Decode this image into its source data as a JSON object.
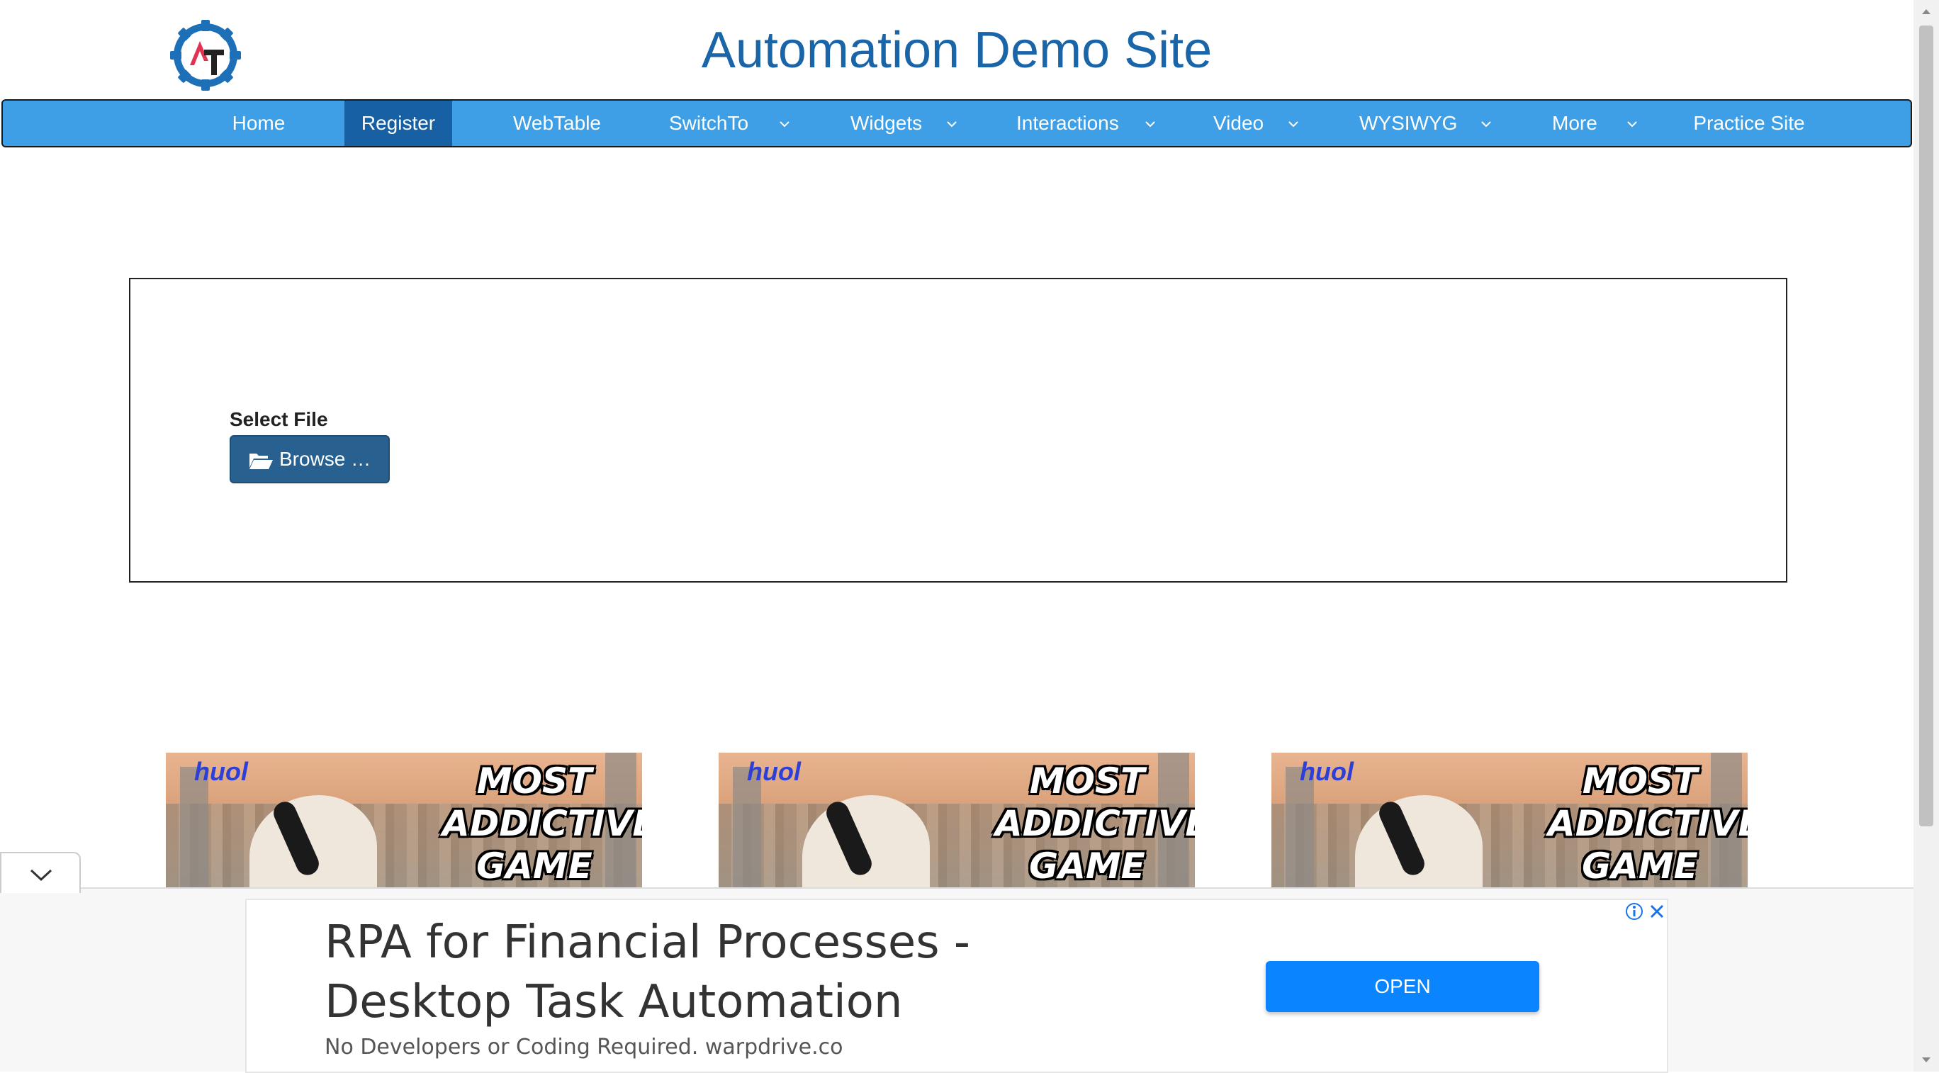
{
  "header": {
    "title": "Automation Demo Site"
  },
  "nav": {
    "items": [
      {
        "label": "Home",
        "active": false,
        "dropdown": false
      },
      {
        "label": "Register",
        "active": true,
        "dropdown": false
      },
      {
        "label": "WebTable",
        "active": false,
        "dropdown": false
      },
      {
        "label": "SwitchTo",
        "active": false,
        "dropdown": true
      },
      {
        "label": "Widgets",
        "active": false,
        "dropdown": true
      },
      {
        "label": "Interactions",
        "active": false,
        "dropdown": true
      },
      {
        "label": "Video",
        "active": false,
        "dropdown": true
      },
      {
        "label": "WYSIWYG",
        "active": false,
        "dropdown": true
      },
      {
        "label": "More",
        "active": false,
        "dropdown": true
      },
      {
        "label": "Practice Site",
        "active": false,
        "dropdown": false
      }
    ]
  },
  "upload": {
    "label": "Select File",
    "browse_label": "Browse …"
  },
  "ad_images": [
    {
      "brand": "huol",
      "text": "MOST ADDICTIVE GAME"
    },
    {
      "brand": "huol",
      "text": "MOST ADDICTIVE GAME"
    },
    {
      "brand": "huol",
      "text": "MOST ADDICTIVE GAME"
    }
  ],
  "bottom_ad": {
    "headline": "RPA for Financial Processes - Desktop Task Automation",
    "subtext": "No Developers or Coding Required. warpdrive.co",
    "button": "OPEN"
  },
  "colors": {
    "title": "#1a64a8",
    "nav_bg": "#3e9fe6",
    "nav_active": "#1660a3",
    "browse_btn": "#286090",
    "ad_button": "#0a84ff"
  },
  "icons": {
    "logo": "gear-logo-icon",
    "browse": "folder-open-icon",
    "dropdown": "chevron-down-icon",
    "collapse": "chevron-down-icon",
    "ad_info": "info-icon",
    "ad_close": "close-icon"
  }
}
